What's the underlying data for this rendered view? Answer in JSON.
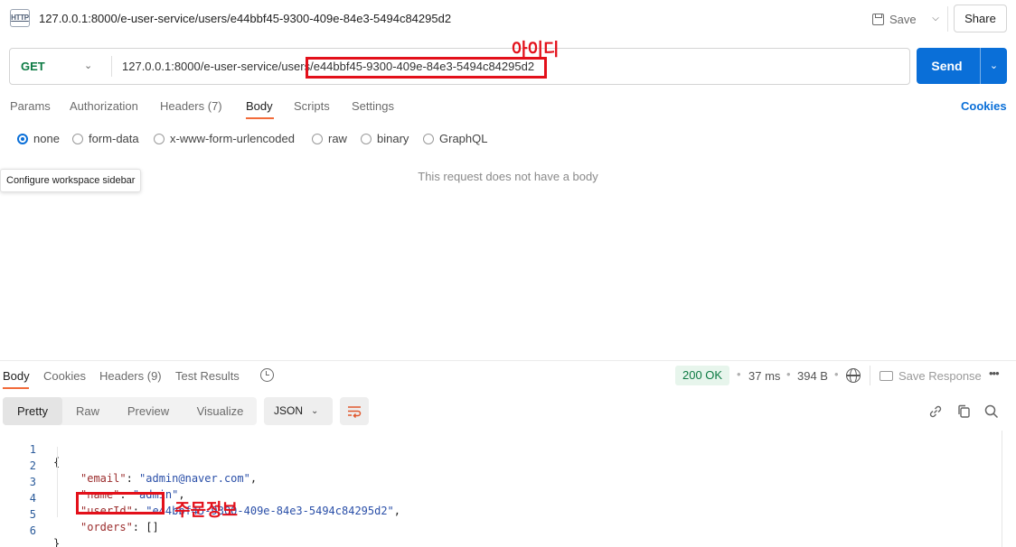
{
  "header": {
    "icon_label": "HTTP",
    "title": "127.0.0.1:8000/e-user-service/users/e44bbf45-9300-409e-84e3-5494c84295d2",
    "save_label": "Save",
    "share_label": "Share"
  },
  "request": {
    "method": "GET",
    "url": "127.0.0.1:8000/e-user-service/users/e44bbf45-9300-409e-84e3-5494c84295d2",
    "send_label": "Send",
    "tabs": [
      {
        "label": "Params"
      },
      {
        "label": "Authorization"
      },
      {
        "label": "Headers (7)"
      },
      {
        "label": "Body"
      },
      {
        "label": "Scripts"
      },
      {
        "label": "Settings"
      }
    ],
    "active_tab": "Body",
    "cookies_label": "Cookies",
    "body_types": [
      "none",
      "form-data",
      "x-www-form-urlencoded",
      "raw",
      "binary",
      "GraphQL"
    ],
    "selected_body_type": "none",
    "empty_body_message": "This request does not have a body",
    "tooltip": "Configure workspace sidebar"
  },
  "annotations": {
    "id_label": "아이디",
    "orders_label": "주문정보",
    "color": "#e3101a"
  },
  "response": {
    "tabs": [
      {
        "label": "Body"
      },
      {
        "label": "Cookies"
      },
      {
        "label": "Headers (9)"
      },
      {
        "label": "Test Results"
      }
    ],
    "active_tab": "Body",
    "status": "200 OK",
    "time": "37 ms",
    "size": "394 B",
    "save_label": "Save Response",
    "view_modes": [
      "Pretty",
      "Raw",
      "Preview",
      "Visualize"
    ],
    "active_view": "Pretty",
    "format": "JSON",
    "code_lines": [
      {
        "n": "1",
        "text": "{"
      },
      {
        "n": "2",
        "key": "\"email\"",
        "value": "\"admin@naver.com\"",
        "suffix": ","
      },
      {
        "n": "3",
        "key": "\"name\"",
        "value": "\"admin\"",
        "suffix": ","
      },
      {
        "n": "4",
        "key": "\"userId\"",
        "value": "\"e44bbf45-9300-409e-84e3-5494c84295d2\"",
        "suffix": ","
      },
      {
        "n": "5",
        "key": "\"orders\"",
        "value": "[]",
        "suffix": ""
      },
      {
        "n": "6",
        "text": "}"
      }
    ]
  },
  "colors": {
    "accent_blue": "#0a6fd8",
    "method_green": "#0c7a43",
    "tab_underline": "#f26b3a"
  }
}
